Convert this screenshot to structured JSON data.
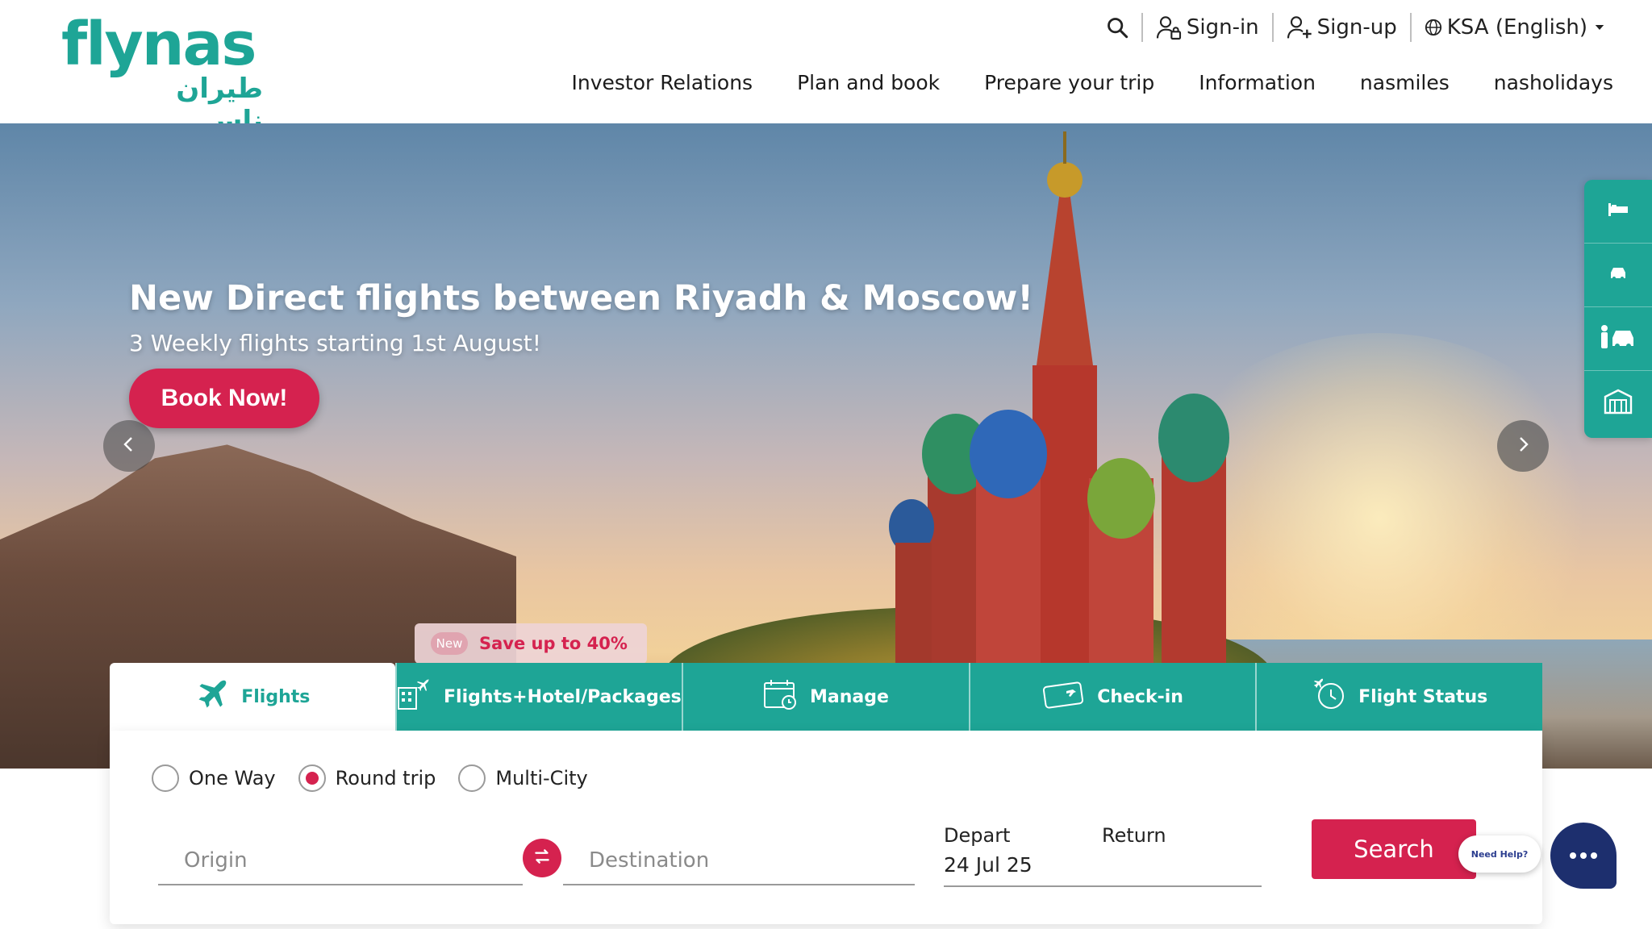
{
  "brand": {
    "name": "flynas",
    "arabic_name": "طيران ناس",
    "primary_color": "#1ea596",
    "accent_color": "#d5224f"
  },
  "utility_nav": {
    "search_icon": "search-icon",
    "signin_label": "Sign-in",
    "signup_label": "Sign-up",
    "locale_label": "KSA (English)"
  },
  "main_nav": [
    {
      "label": "Investor Relations"
    },
    {
      "label": "Plan and book"
    },
    {
      "label": "Prepare your trip"
    },
    {
      "label": "Information"
    },
    {
      "label": "nasmiles"
    },
    {
      "label": "nasholidays"
    }
  ],
  "hero": {
    "title": "New Direct flights between Riyadh & Moscow!",
    "subtitle": "3 Weekly flights starting 1st August!",
    "cta_label": "Book Now!",
    "promo_badge": "New",
    "promo_text": "Save up to 40%"
  },
  "side_rail": [
    {
      "icon": "hotel-bed-icon"
    },
    {
      "icon": "car-icon"
    },
    {
      "icon": "person-car-icon"
    },
    {
      "icon": "building-icon"
    }
  ],
  "booking": {
    "tabs": [
      {
        "label": "Flights",
        "icon": "plane-icon",
        "active": true
      },
      {
        "label": "Flights+Hotel/Packages",
        "icon": "hotel-plane-icon",
        "active": false
      },
      {
        "label": "Manage",
        "icon": "calendar-icon",
        "active": false
      },
      {
        "label": "Check-in",
        "icon": "ticket-icon",
        "active": false
      },
      {
        "label": "Flight Status",
        "icon": "flight-status-icon",
        "active": false
      }
    ],
    "trip_types": [
      {
        "label": "One Way",
        "checked": false
      },
      {
        "label": "Round trip",
        "checked": true
      },
      {
        "label": "Multi-City",
        "checked": false
      }
    ],
    "origin_placeholder": "Origin",
    "destination_placeholder": "Destination",
    "depart_label": "Depart",
    "depart_value": "24 Jul 25",
    "return_label": "Return",
    "search_label": "Search"
  },
  "help": {
    "need_help_label": "Need Help?"
  }
}
